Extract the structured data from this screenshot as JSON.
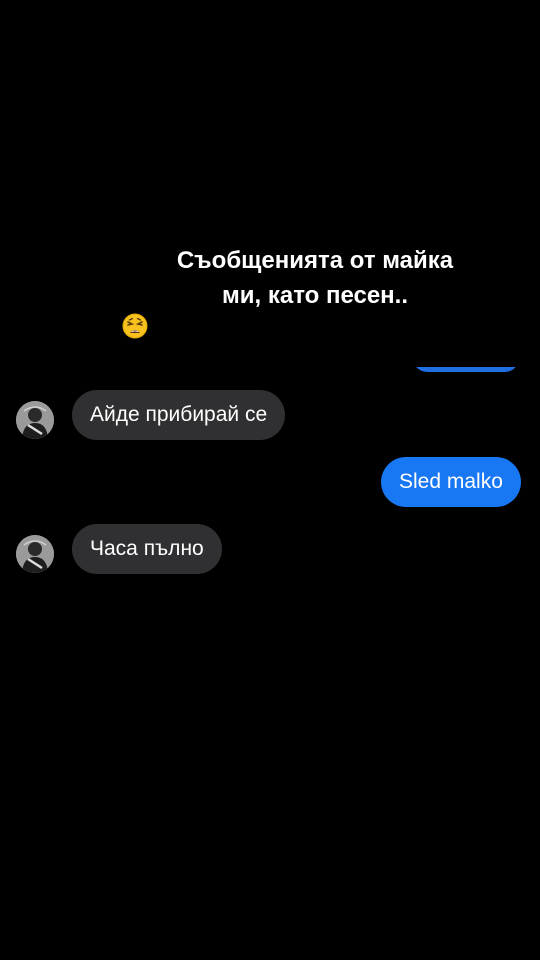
{
  "caption": {
    "line1": "Съобщенията от майка",
    "line2": "ми, като песен..",
    "emoji": "weary-face-emoji"
  },
  "messages": [
    {
      "direction": "incoming",
      "text": "Айде прибирай се",
      "avatar": "contact-avatar"
    },
    {
      "direction": "outgoing",
      "text": "Sled malko"
    },
    {
      "direction": "incoming",
      "text": "Часа пълно",
      "avatar": "contact-avatar"
    }
  ],
  "colors": {
    "background": "#000000",
    "incoming_bubble": "#303032",
    "outgoing_bubble": "#1877f2",
    "text": "#ffffff"
  }
}
